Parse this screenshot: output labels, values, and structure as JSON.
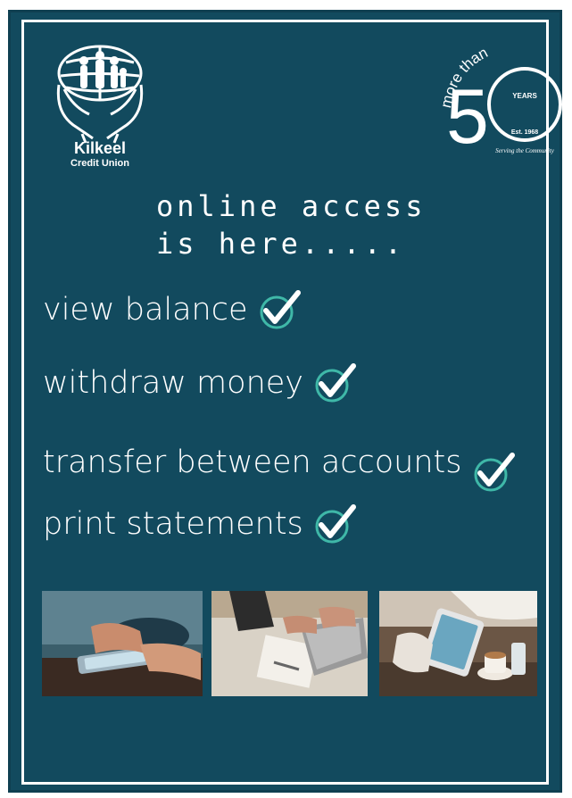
{
  "logo": {
    "line1": "Kilkeel",
    "line2": "Credit Union"
  },
  "badge": {
    "more_than": "more than",
    "years": "YEARS",
    "est": "Est. 1968",
    "tagline": "Serving the Community"
  },
  "headline": {
    "line1": "online access",
    "line2": "is here....."
  },
  "features": [
    {
      "label": "view balance"
    },
    {
      "label": "withdraw money"
    },
    {
      "label": "transfer between accounts"
    },
    {
      "label": "print statements"
    }
  ],
  "colors": {
    "background": "#124a5e",
    "check_ring": "#3fb8a8",
    "text": "#ffffff"
  },
  "photos": [
    {
      "subject": "hands-holding-phone"
    },
    {
      "subject": "hands-on-laptop"
    },
    {
      "subject": "hands-holding-tablet"
    }
  ]
}
